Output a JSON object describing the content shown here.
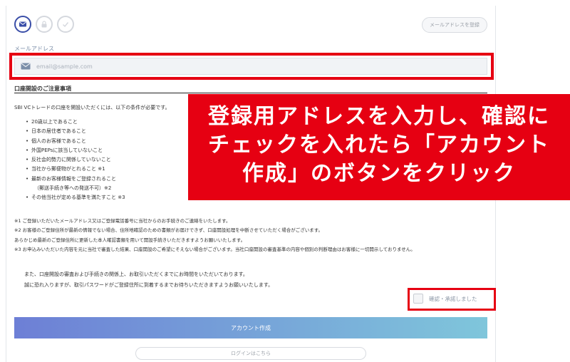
{
  "header": {
    "steps": [
      {
        "icon": "envelope-icon",
        "active": true
      },
      {
        "icon": "lock-icon",
        "active": false
      },
      {
        "icon": "check-icon",
        "active": false
      }
    ],
    "mail_address_button": "メールアドレスを登録"
  },
  "email": {
    "label": "メールアドレス",
    "placeholder": "email@sample.com"
  },
  "notes": {
    "title": "口座開設のご注意事項",
    "intro": "SBI VCトレードの口座を開設いただくには、以下の条件が必要です。",
    "conditions": [
      "20歳以上であること",
      "日本の居住者であること",
      "個人のお客様であること",
      "外国PEPsに該当していないこと",
      "反社会的勢力に関係していないこと",
      "当社から郵便物がとれること ※1",
      "最新のお客様情報をご登録されること",
      "（郵送手続き等への発送不可）※2",
      "その他当社が定める基準を満たすこと ※3"
    ],
    "footnotes": [
      "※1 ご登録いただいたメールアドレス又はご登録電話番号に当社からのお手続きのご連絡をいたします。",
      "※2 お客様のご登録住所が最新の情報でない場合、住所地確認のための書類がお届けできず、口座開設処理を中断させていただく場合がございます。",
      "あらかじめ最新のご登録住所に更新した本人確認書類を用いて開設手続きいただきますようお願いいたします。",
      "※3 お申込みいただいた内容を元に当社で審査した結果、口座開設のご希望にそえない場合がございます。当社口座開設の審査基準の内容や個別の判断理由はお客様に一切開示しておりません。"
    ],
    "para2": [
      "また、口座開設の審査および手続きの関係上、お取引いただくまでにお時間をいただいております。",
      "誠に恐れ入りますが、取引パスワードがご登録住所に到着するまでお待ちいただきますようお願いいたします。"
    ]
  },
  "confirm_label": "確認・承諾しました",
  "create_account_button": "アカウント作成",
  "login_button": "ログインはこちら",
  "callout": {
    "line1": "登録用アドレスを入力し、確認に",
    "line2": "チェックを入れたら「アカウント",
    "line3": "作成」のボタンをクリック"
  },
  "colors": {
    "highlight_red": "#e60012",
    "accent_blue": "#3a4ea8",
    "button_gradient_start": "#6d7fd6",
    "button_gradient_end": "#7fc6db"
  }
}
